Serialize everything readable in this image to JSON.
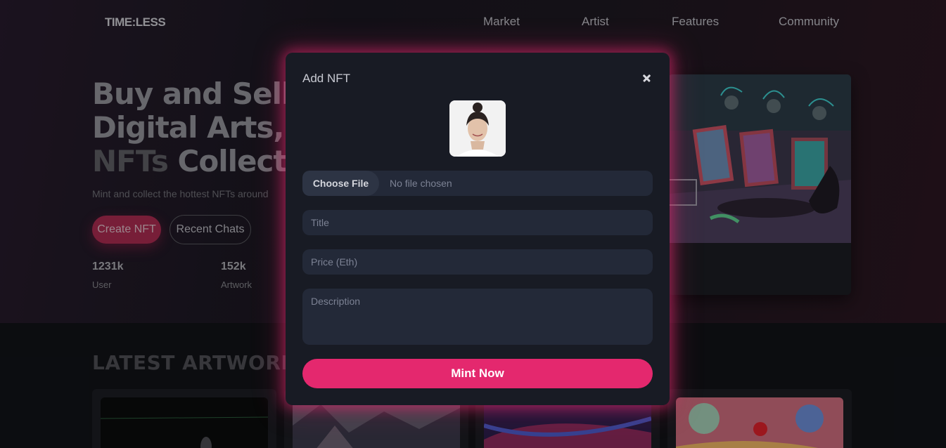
{
  "header": {
    "logo": "TIME:LESS",
    "nav": [
      "Market",
      "Artist",
      "Features",
      "Community"
    ]
  },
  "hero": {
    "title_line1": "Buy and Sell",
    "title_line2": "Digital Arts,",
    "title_line3_muted": "NFTs",
    "title_line3_rest": " Collections",
    "subtitle": "Mint and collect the hottest NFTs around",
    "create_button": "Create NFT",
    "chats_button": "Recent Chats",
    "stats": [
      {
        "value": "1231k",
        "label": "User"
      },
      {
        "value": "152k",
        "label": "Artwork"
      }
    ]
  },
  "latest": {
    "title": "LATEST ARTWORKS"
  },
  "modal": {
    "title": "Add NFT",
    "choose_file": "Choose File",
    "file_status": "No file chosen",
    "title_placeholder": "Title",
    "price_placeholder": "Price (Eth)",
    "description_placeholder": "Description",
    "mint_button": "Mint Now"
  },
  "colors": {
    "accent": "#e4286e",
    "modal_bg": "#181b24",
    "input_bg": "#232938"
  }
}
